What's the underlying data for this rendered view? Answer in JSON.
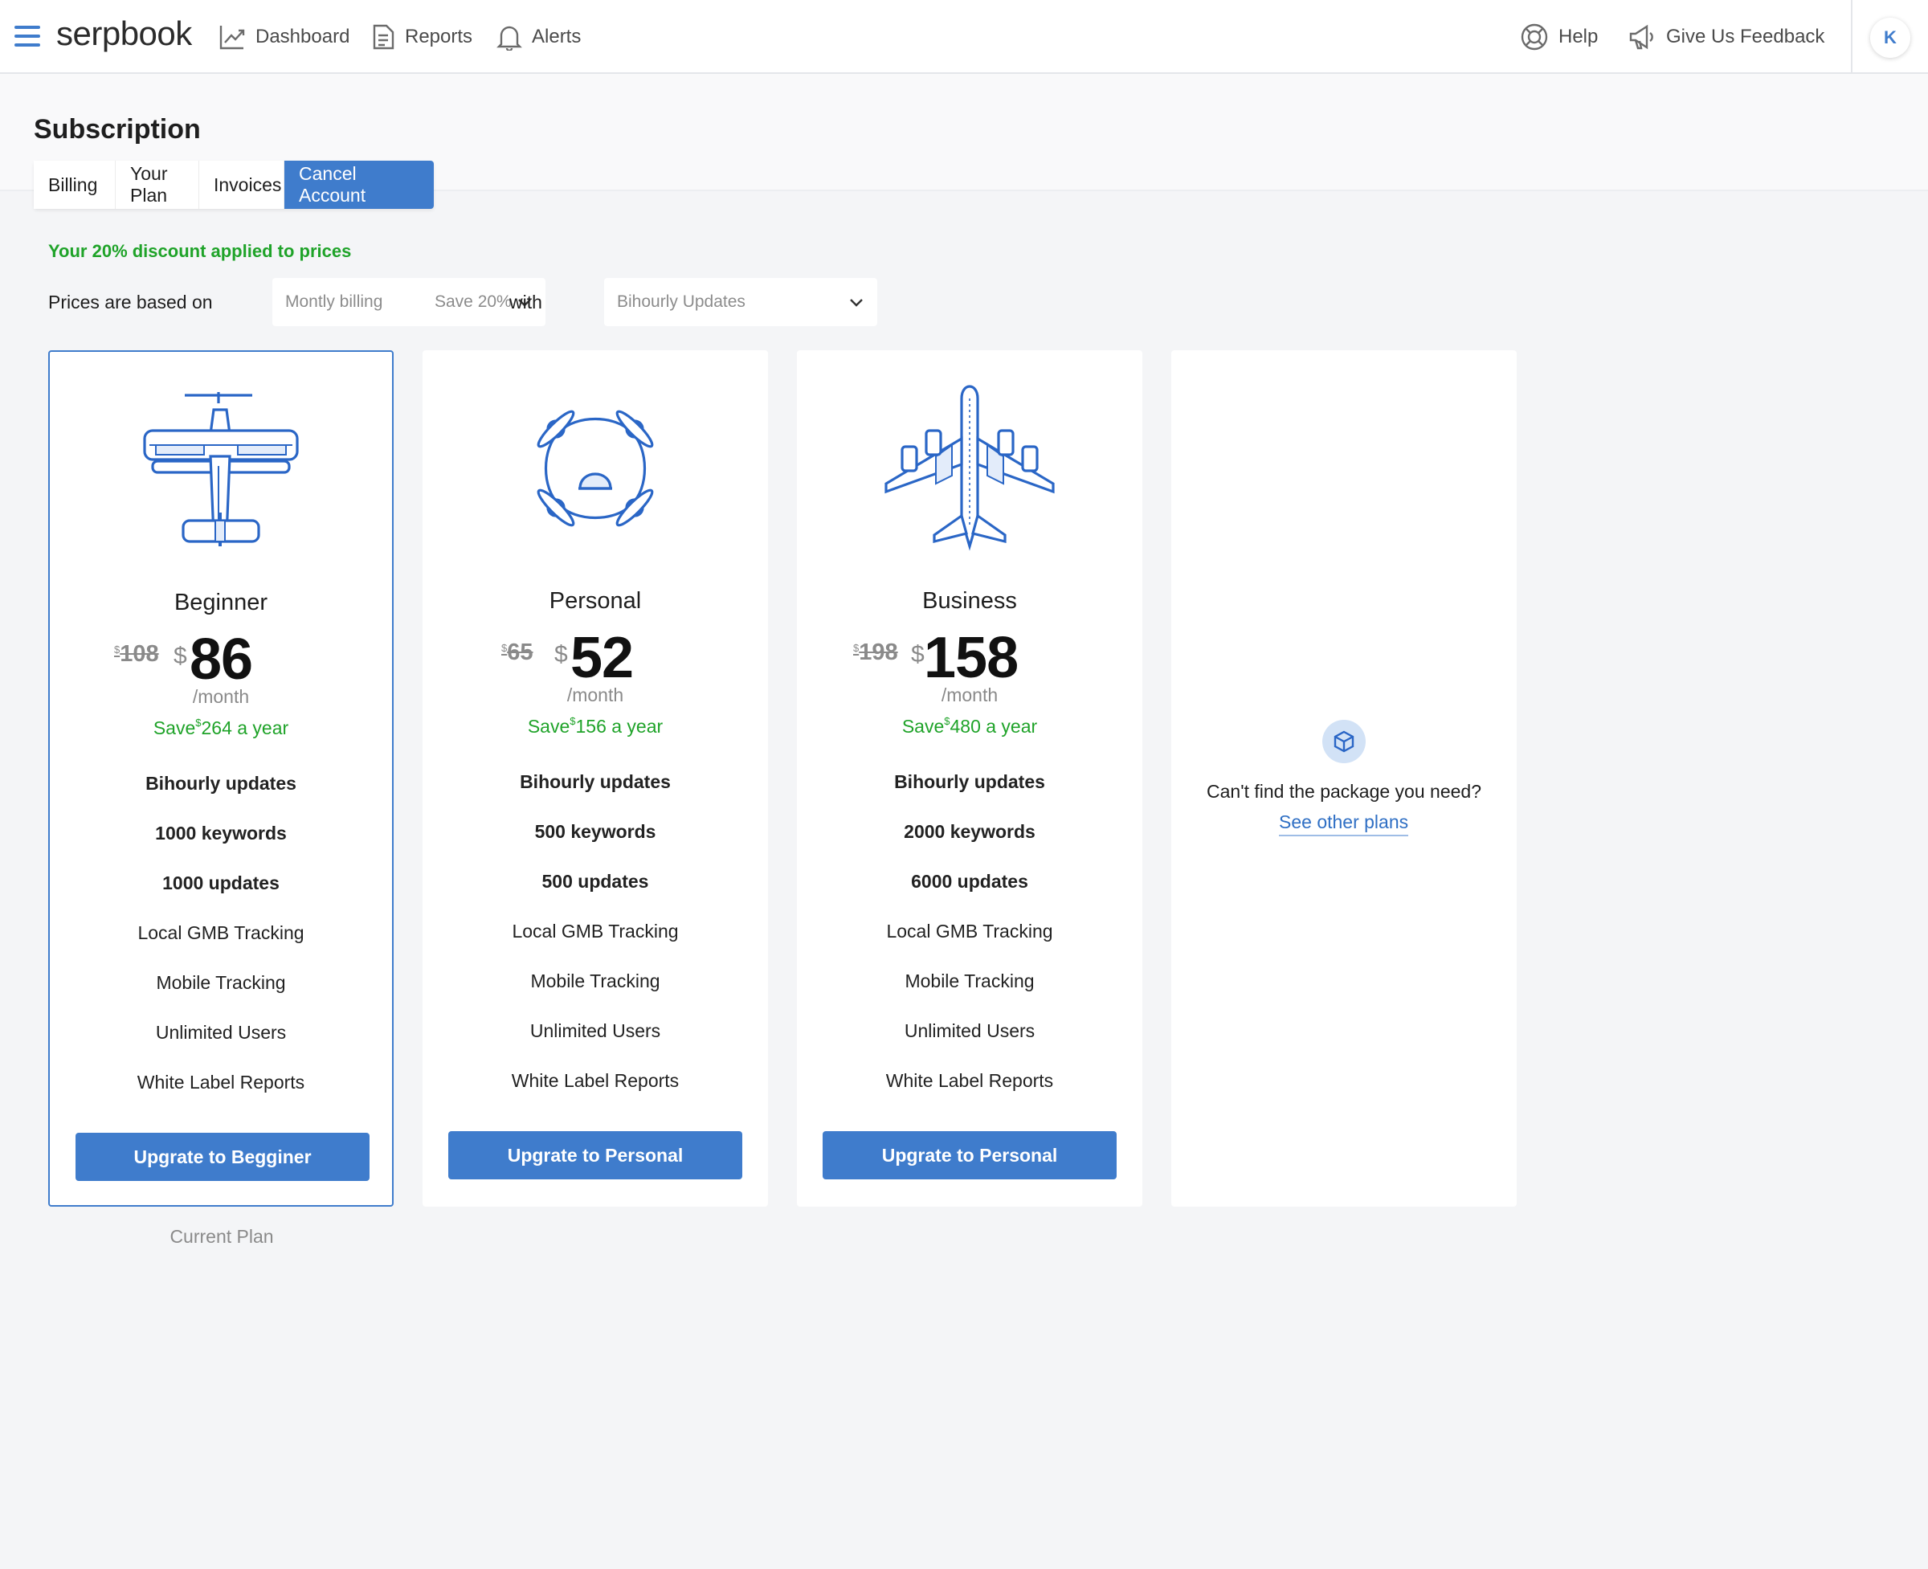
{
  "app": {
    "logo": "serpbook",
    "avatar_initial": "K"
  },
  "nav": {
    "dashboard": "Dashboard",
    "reports": "Reports",
    "alerts": "Alerts",
    "help": "Help",
    "feedback": "Give Us Feedback"
  },
  "page": {
    "title": "Subscription"
  },
  "tabs": [
    "Billing",
    "Your Plan",
    "Invoices",
    "Cancel Account"
  ],
  "discount_text": "Your 20% discount applied to prices",
  "pricing_controls": {
    "prefix": "Prices are based on",
    "billing_value": "Montly billing",
    "billing_save": "Save 20%",
    "with": "with",
    "updates_value": "Bihourly Updates"
  },
  "plans": [
    {
      "name": "Beginner",
      "old_price": "108",
      "price": "86",
      "per": "/month",
      "save_prefix": "Save",
      "save_amount": "264 a year",
      "currency": "$",
      "features": [
        "Bihourly updates",
        "1000 keywords",
        "1000 updates",
        "Local GMB Tracking",
        "Mobile Tracking",
        "Unlimited Users",
        "White Label Reports"
      ],
      "button": "Upgrate to Begginer",
      "current": true
    },
    {
      "name": "Personal",
      "old_price": "65",
      "price": "52",
      "per": "/month",
      "save_prefix": "Save",
      "save_amount": "156 a year",
      "currency": "$",
      "features": [
        "Bihourly updates",
        "500 keywords",
        "500 updates",
        "Local GMB Tracking",
        "Mobile Tracking",
        "Unlimited Users",
        "White Label Reports"
      ],
      "button": "Upgrate to Personal",
      "current": false
    },
    {
      "name": "Business",
      "old_price": "198",
      "price": "158",
      "per": "/month",
      "save_prefix": "Save",
      "save_amount": "480 a year",
      "currency": "$",
      "features": [
        "Bihourly updates",
        "2000 keywords",
        "6000 updates",
        "Local GMB Tracking",
        "Mobile Tracking",
        "Unlimited Users",
        "White Label Reports"
      ],
      "button": "Upgrate to Personal",
      "current": false
    }
  ],
  "current_plan_label": "Current Plan",
  "other_plans": {
    "text": "Can't find the package you need?",
    "link": "See other plans"
  },
  "colors": {
    "accent": "#3f7ccc",
    "success": "#1fa329"
  },
  "icons": {
    "menu": "hamburger-icon",
    "dashboard": "chart-line-icon",
    "reports": "document-icon",
    "alerts": "bell-icon",
    "help": "lifebuoy-icon",
    "feedback": "megaphone-icon",
    "package": "cube-icon"
  }
}
